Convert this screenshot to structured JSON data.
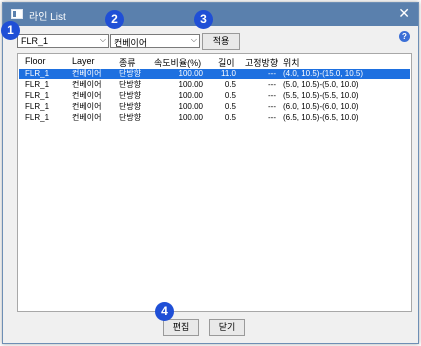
{
  "window": {
    "title": "라인 List"
  },
  "help": {
    "symbol": "?"
  },
  "close": {
    "symbol": "✕"
  },
  "filters": {
    "floor_value": "FLR_1",
    "layer_value": "컨베이어",
    "apply_label": "적용"
  },
  "columns": [
    "Floor",
    "Layer",
    "종류",
    "속도비율(%)",
    "길이",
    "고정방향",
    "위치"
  ],
  "rows": [
    {
      "floor": "FLR_1",
      "layer": "컨베이어",
      "type": "단방향",
      "speed": "100.00",
      "length": "11.0",
      "fixed": "---",
      "position": "(4.0, 10.5)-(15.0, 10.5)",
      "selected": true
    },
    {
      "floor": "FLR_1",
      "layer": "컨베이어",
      "type": "단방향",
      "speed": "100.00",
      "length": "0.5",
      "fixed": "---",
      "position": "(5.0, 10.5)-(5.0, 10.0)",
      "selected": false
    },
    {
      "floor": "FLR_1",
      "layer": "컨베이어",
      "type": "단방향",
      "speed": "100.00",
      "length": "0.5",
      "fixed": "---",
      "position": "(5.5, 10.5)-(5.5, 10.0)",
      "selected": false
    },
    {
      "floor": "FLR_1",
      "layer": "컨베이어",
      "type": "단방향",
      "speed": "100.00",
      "length": "0.5",
      "fixed": "---",
      "position": "(6.0, 10.5)-(6.0, 10.0)",
      "selected": false
    },
    {
      "floor": "FLR_1",
      "layer": "컨베이어",
      "type": "단방향",
      "speed": "100.00",
      "length": "0.5",
      "fixed": "---",
      "position": "(6.5, 10.5)-(6.5, 10.0)",
      "selected": false
    }
  ],
  "footer": {
    "edit_label": "편집",
    "close_label": "닫기"
  },
  "badges": [
    "1",
    "2",
    "3",
    "4"
  ],
  "colors": {
    "titlebar": "#5a80ad",
    "selection": "#1e70e0",
    "badge": "#1f4fd6"
  }
}
